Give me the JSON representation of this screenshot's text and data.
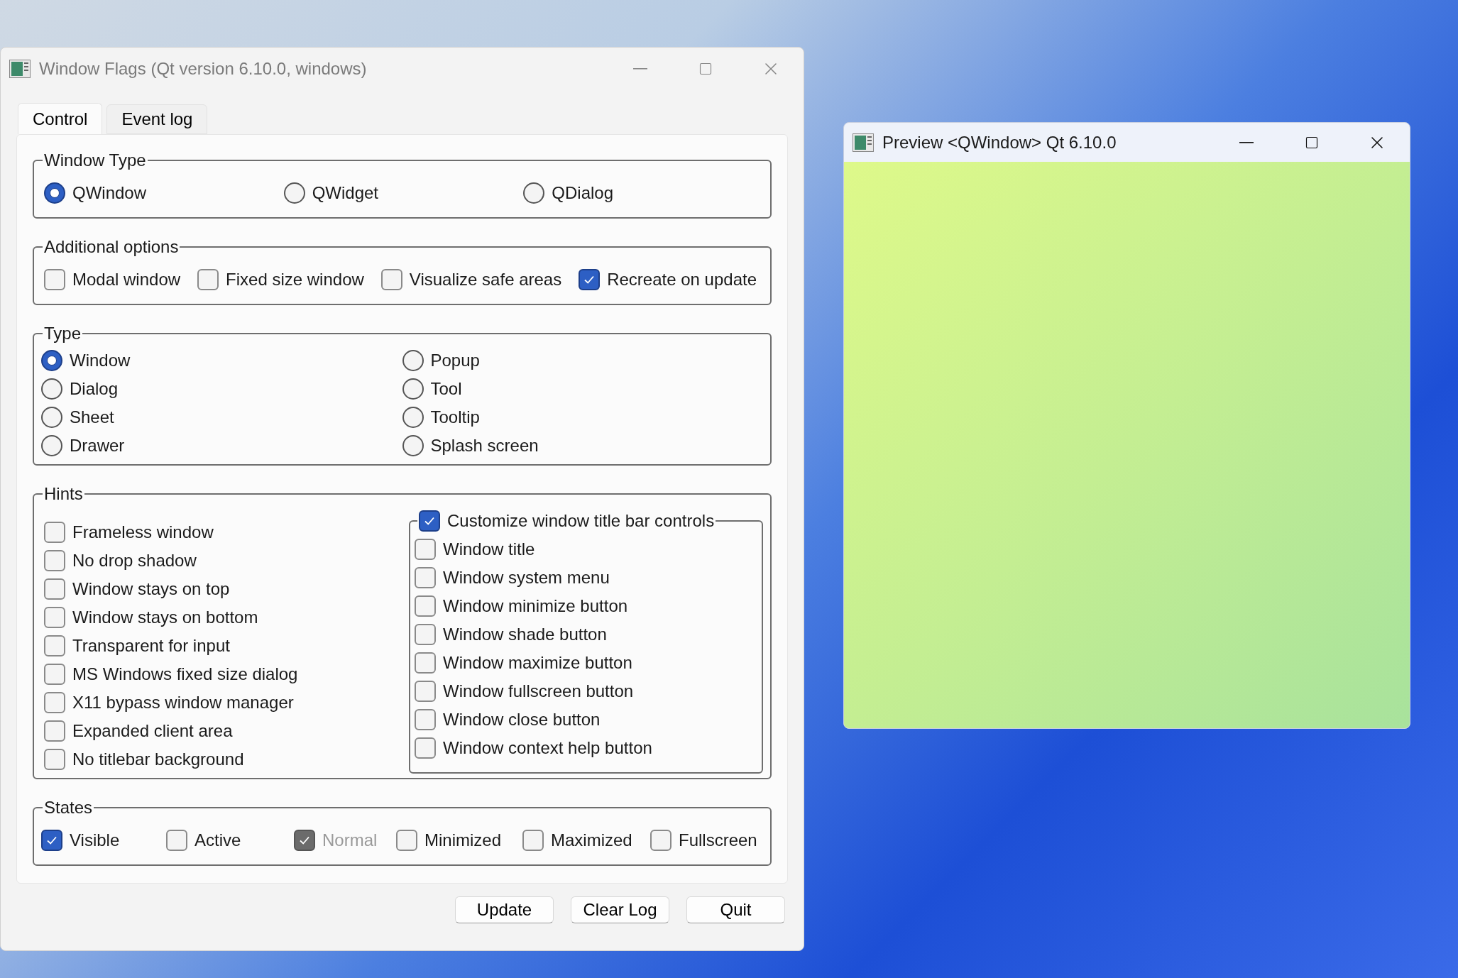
{
  "window": {
    "title": "Window Flags (Qt version 6.10.0, windows)"
  },
  "tabs": [
    {
      "label": "Control",
      "selected": true
    },
    {
      "label": "Event log",
      "selected": false
    }
  ],
  "window_type": {
    "title": "Window Type",
    "options": [
      {
        "label": "QWindow",
        "selected": true
      },
      {
        "label": "QWidget",
        "selected": false
      },
      {
        "label": "QDialog",
        "selected": false
      }
    ]
  },
  "additional_options": {
    "title": "Additional options",
    "options": [
      {
        "label": "Modal window",
        "checked": false
      },
      {
        "label": "Fixed size window",
        "checked": false
      },
      {
        "label": "Visualize safe areas",
        "checked": false
      },
      {
        "label": "Recreate on update",
        "checked": true
      }
    ]
  },
  "type": {
    "title": "Type",
    "options": [
      {
        "label": "Window",
        "selected": true
      },
      {
        "label": "Dialog",
        "selected": false
      },
      {
        "label": "Sheet",
        "selected": false
      },
      {
        "label": "Drawer",
        "selected": false
      },
      {
        "label": "Popup",
        "selected": false
      },
      {
        "label": "Tool",
        "selected": false
      },
      {
        "label": "Tooltip",
        "selected": false
      },
      {
        "label": "Splash screen",
        "selected": false
      }
    ]
  },
  "hints": {
    "title": "Hints",
    "options": [
      {
        "label": "Frameless window",
        "checked": false
      },
      {
        "label": "No drop shadow",
        "checked": false
      },
      {
        "label": "Window stays on top",
        "checked": false
      },
      {
        "label": "Window stays on bottom",
        "checked": false
      },
      {
        "label": "Transparent for input",
        "checked": false
      },
      {
        "label": "MS Windows fixed size dialog",
        "checked": false
      },
      {
        "label": "X11 bypass window manager",
        "checked": false
      },
      {
        "label": "Expanded client area",
        "checked": false
      },
      {
        "label": "No titlebar background",
        "checked": false
      }
    ],
    "customize": {
      "label": "Customize window title bar controls",
      "checked": true,
      "options": [
        {
          "label": "Window title",
          "checked": false
        },
        {
          "label": "Window system menu",
          "checked": false
        },
        {
          "label": "Window minimize button",
          "checked": false
        },
        {
          "label": "Window shade button",
          "checked": false
        },
        {
          "label": "Window maximize button",
          "checked": false
        },
        {
          "label": "Window fullscreen button",
          "checked": false
        },
        {
          "label": "Window close button",
          "checked": false
        },
        {
          "label": "Window context help button",
          "checked": false
        }
      ]
    }
  },
  "states": {
    "title": "States",
    "options": [
      {
        "label": "Visible",
        "checked": true,
        "disabled": false
      },
      {
        "label": "Active",
        "checked": false,
        "disabled": false
      },
      {
        "label": "Normal",
        "checked": true,
        "disabled": true
      },
      {
        "label": "Minimized",
        "checked": false,
        "disabled": false
      },
      {
        "label": "Maximized",
        "checked": false,
        "disabled": false
      },
      {
        "label": "Fullscreen",
        "checked": false,
        "disabled": false
      }
    ]
  },
  "buttons": [
    "Update",
    "Clear Log",
    "Quit"
  ],
  "preview": {
    "title": "Preview <QWindow> Qt 6.10.0"
  }
}
